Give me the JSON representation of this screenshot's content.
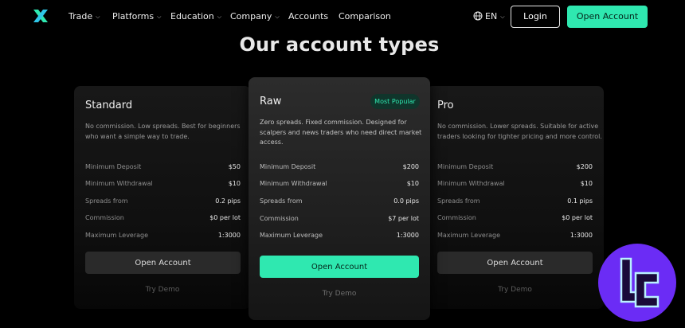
{
  "nav": {
    "items": [
      {
        "label": "Trade",
        "chevron": true
      },
      {
        "label": "Platforms",
        "chevron": true
      },
      {
        "label": "Education",
        "chevron": true
      },
      {
        "label": "Company",
        "chevron": true
      },
      {
        "label": "Accounts",
        "chevron": false
      },
      {
        "label": "Comparison",
        "chevron": false
      }
    ],
    "language": "EN",
    "login_label": "Login",
    "open_account_label": "Open Account"
  },
  "page_title": "Our account types",
  "cards": [
    {
      "name": "Standard",
      "description_lines": [
        "No commission. Low spreads. Best for beginners",
        "who want a simple way to trade."
      ],
      "badge": "",
      "specs": [
        {
          "label": "Minimum Deposit",
          "value": "$50"
        },
        {
          "label": "Minimum Withdrawal",
          "value": "$10"
        },
        {
          "label": "Spreads from",
          "value": "0.2 pips"
        },
        {
          "label": "Commission",
          "value": "$0 per lot"
        },
        {
          "label": "Maximum Leverage",
          "value": "1:3000"
        }
      ],
      "cta": "Open Account",
      "demo": "Try Demo"
    },
    {
      "name": "Raw",
      "description_lines": [
        "Zero spreads. Fixed commission. Designed for",
        "scalpers and news traders who need direct market",
        "access."
      ],
      "badge": "Most Popular",
      "specs": [
        {
          "label": "Minimum Deposit",
          "value": "$200"
        },
        {
          "label": "Minimum Withdrawal",
          "value": "$10"
        },
        {
          "label": "Spreads from",
          "value": "0.0 pips"
        },
        {
          "label": "Commission",
          "value": "$7 per lot"
        },
        {
          "label": "Maximum Leverage",
          "value": "1:3000"
        }
      ],
      "cta": "Open Account",
      "demo": "Try Demo"
    },
    {
      "name": "Pro",
      "description_lines": [
        "No commission. Lower spreads. Suitable for active",
        "traders looking for tighter pricing and more control."
      ],
      "badge": "",
      "specs": [
        {
          "label": "Minimum Deposit",
          "value": "$200"
        },
        {
          "label": "Minimum Withdrawal",
          "value": "$10"
        },
        {
          "label": "Spreads from",
          "value": "0.1 pips"
        },
        {
          "label": "Commission",
          "value": "$0 per lot"
        },
        {
          "label": "Maximum Leverage",
          "value": "1:3000"
        }
      ],
      "cta": "Open Account",
      "demo": "Try Demo"
    }
  ],
  "colors": {
    "accent": "#2fe8b0",
    "badge_bg": "#10352b",
    "background": "#000000",
    "brand_mark": "#6b2cf5"
  },
  "icons": [
    "brand-logo-icon",
    "globe-icon",
    "chevron-down-icon",
    "corner-brand-mark-icon"
  ]
}
